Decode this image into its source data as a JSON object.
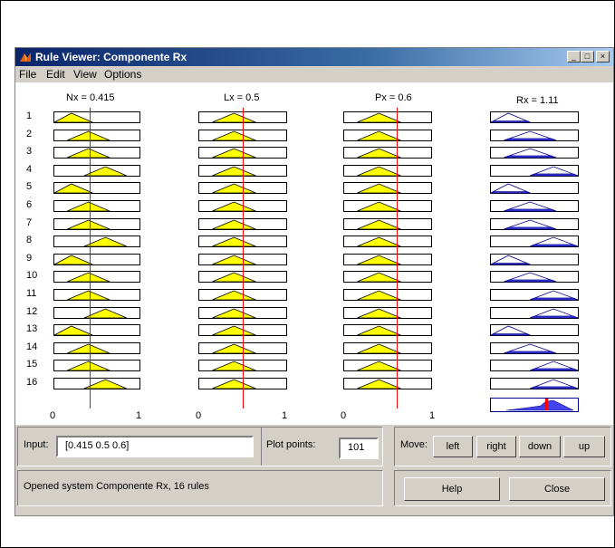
{
  "window": {
    "title": "Rule Viewer: Componente Rx",
    "minimize_label": "_",
    "maximize_label": "□",
    "close_label": "×"
  },
  "menu": [
    "File",
    "Edit",
    "View",
    "Options"
  ],
  "variables": [
    {
      "header": "Nx = 0.415",
      "value": 0.415,
      "ticks": [
        "0",
        "1"
      ]
    },
    {
      "header": "Lx = 0.5",
      "value": 0.5,
      "ticks": [
        "0",
        "1"
      ]
    },
    {
      "header": "Px = 0.6",
      "value": 0.6,
      "ticks": [
        "0",
        "1"
      ]
    }
  ],
  "output": {
    "header": "Rx = 1.11"
  },
  "rule_numbers": [
    "1",
    "2",
    "3",
    "4",
    "5",
    "6",
    "7",
    "8",
    "9",
    "10",
    "11",
    "12",
    "13",
    "14",
    "15",
    "16"
  ],
  "input_mfs": [
    [
      "low",
      "mid",
      "mid"
    ],
    [
      "mid",
      "mid",
      "mid"
    ],
    [
      "mid",
      "mid",
      "mid"
    ],
    [
      "high",
      "mid",
      "mid"
    ],
    [
      "low",
      "mid",
      "mid"
    ],
    [
      "mid",
      "mid",
      "mid"
    ],
    [
      "mid",
      "mid",
      "mid"
    ],
    [
      "high",
      "mid",
      "mid"
    ],
    [
      "low",
      "mid",
      "mid"
    ],
    [
      "mid",
      "mid",
      "mid"
    ],
    [
      "mid",
      "mid",
      "mid"
    ],
    [
      "high",
      "mid",
      "mid"
    ],
    [
      "low",
      "mid",
      "mid"
    ],
    [
      "mid",
      "mid",
      "mid"
    ],
    [
      "mid",
      "mid",
      "mid"
    ],
    [
      "high",
      "mid",
      "mid"
    ]
  ],
  "output_mfs": [
    "low",
    "mid",
    "mid",
    "high",
    "low",
    "mid",
    "mid",
    "high",
    "low",
    "mid",
    "high",
    "high",
    "low",
    "mid",
    "high",
    "high"
  ],
  "controls": {
    "input_label": "Input:",
    "input_value": "[0.415 0.5 0.6]",
    "plot_points_label": "Plot points:",
    "plot_points_value": "101",
    "move_label": "Move:",
    "left": "left",
    "right": "right",
    "down": "down",
    "up": "up",
    "status": "Opened system Componente Rx, 16 rules",
    "help": "Help",
    "close": "Close"
  },
  "colors": {
    "fired_fill": "#ffff00",
    "output_fill": "#4444ee",
    "input_line": "#808000",
    "output_line": "#00008b",
    "cursor": "#ff0000"
  }
}
